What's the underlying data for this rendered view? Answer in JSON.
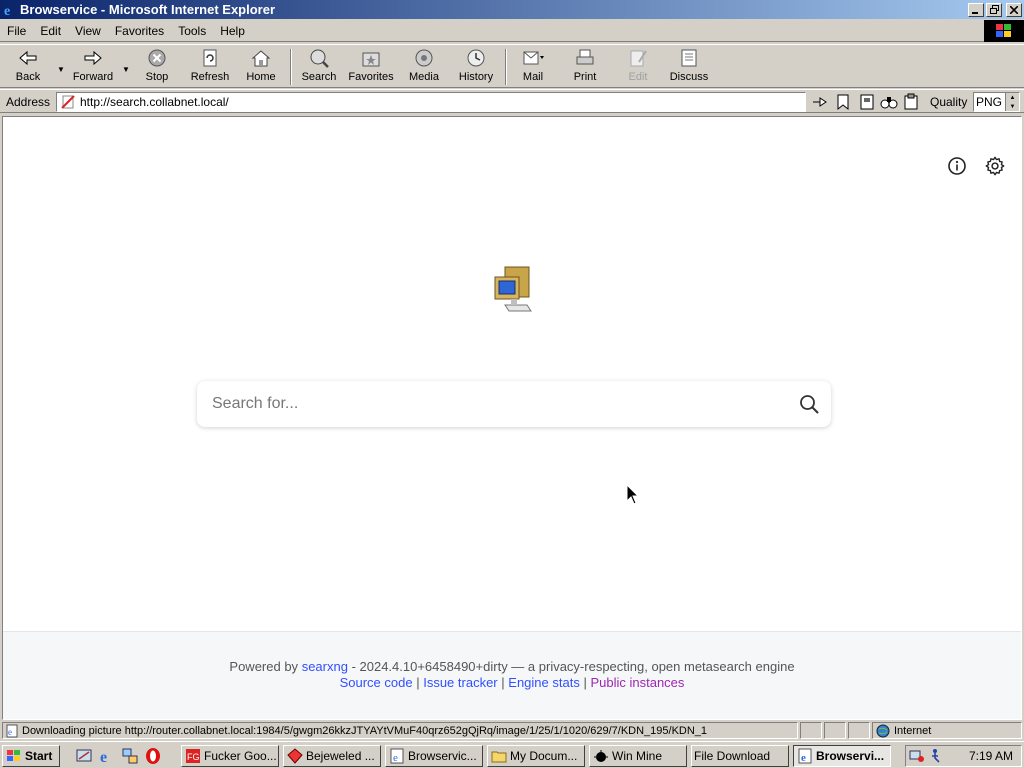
{
  "window": {
    "title": "Browservice - Microsoft Internet Explorer"
  },
  "menu": {
    "items": [
      {
        "label": "File"
      },
      {
        "label": "Edit"
      },
      {
        "label": "View"
      },
      {
        "label": "Favorites"
      },
      {
        "label": "Tools"
      },
      {
        "label": "Help"
      }
    ]
  },
  "toolbar": {
    "back": "Back",
    "forward": "Forward",
    "stop": "Stop",
    "refresh": "Refresh",
    "home": "Home",
    "search": "Search",
    "favorites": "Favorites",
    "media": "Media",
    "history": "History",
    "mail": "Mail",
    "print": "Print",
    "edit": "Edit",
    "discuss": "Discuss"
  },
  "address": {
    "label": "Address",
    "url": "http://search.collabnet.local/",
    "quality_label": "Quality",
    "quality_value": "PNG"
  },
  "page": {
    "search_placeholder": "Search for...",
    "footer": {
      "powered_by": "Powered by",
      "engine_link": "searxng",
      "version_text": "- 2024.4.10+6458490+dirty — a privacy-respecting, open metasearch engine",
      "source_code": "Source code",
      "issue_tracker": "Issue tracker",
      "engine_stats": "Engine stats",
      "public_instances": "Public instances",
      "separator": "|"
    }
  },
  "status": {
    "message": "Downloading picture http://router.collabnet.local:1984/5/gwgm26kkzJTYAYtVMuF40qrz652gQjRq/image/1/25/1/1020/629/7/KDN_195/KDN_1",
    "zone": "Internet"
  },
  "taskbar": {
    "start": "Start",
    "buttons": [
      {
        "label": "Fucker Goo..."
      },
      {
        "label": "Bejeweled ..."
      },
      {
        "label": "Browservic..."
      },
      {
        "label": "My Docum..."
      },
      {
        "label": "Win Mine"
      },
      {
        "label": "File Download"
      },
      {
        "label": "Browservi..."
      }
    ],
    "clock": "7:19 AM"
  }
}
